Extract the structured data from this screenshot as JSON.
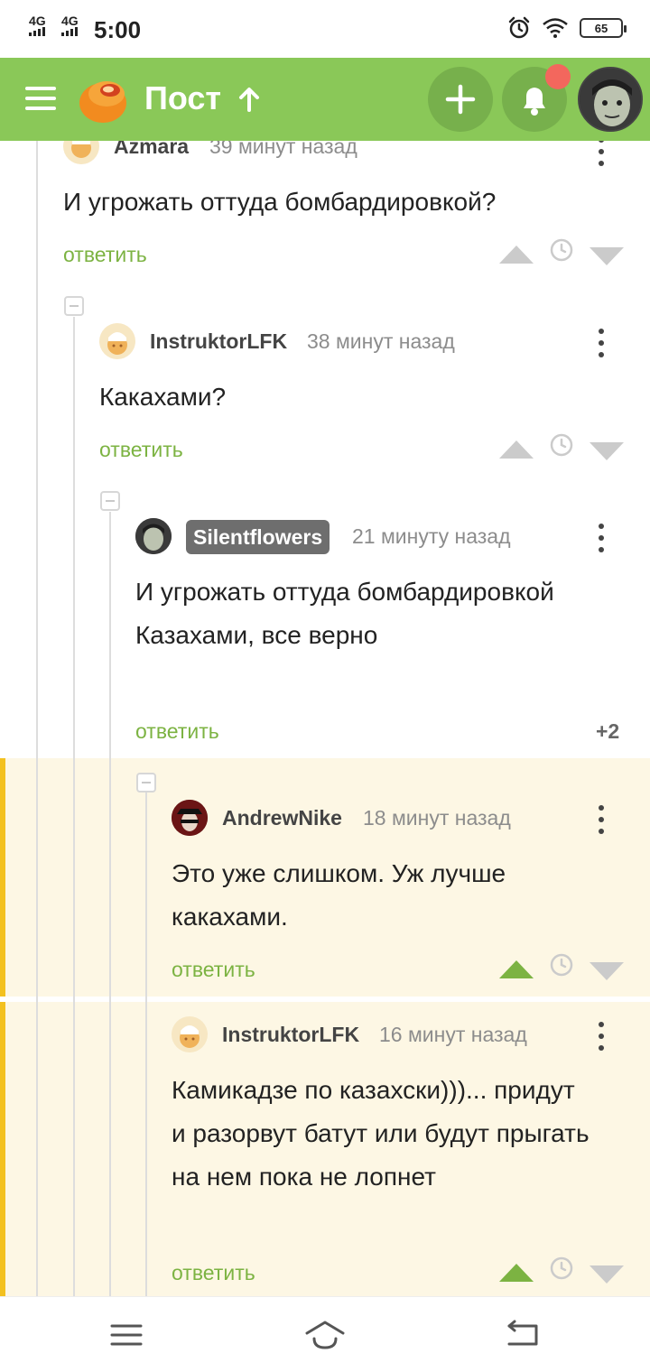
{
  "status_bar": {
    "network1": "4G",
    "network2": "4G",
    "time": "5:00",
    "battery": "65"
  },
  "app_bar": {
    "title": "Пост"
  },
  "comments": [
    {
      "username": "Azmara",
      "time": "39 минут назад",
      "text": "И угрожать оттуда бомбардировкой?",
      "reply": "ответить"
    },
    {
      "username": "InstruktorLFK",
      "time": "38 минут назад",
      "text": "Какахами?",
      "reply": "ответить"
    },
    {
      "username": "Silentflowers",
      "time": "21 минуту назад",
      "text": "И угрожать оттуда бомбардировкой Казахами, все верно",
      "reply": "ответить",
      "rating": "+2"
    },
    {
      "username": "AndrewNike",
      "time": "18 минут назад",
      "text": "Это уже слишком. Уж лучше какахами.",
      "reply": "ответить"
    },
    {
      "username": "InstruktorLFK",
      "time": "16 минут назад",
      "text": "Камикадзе по казахски)))... придут и разорвут батут или будут прыгать на нем пока не лопнет",
      "reply": "ответить"
    }
  ],
  "colors": {
    "app_bar": "#8ac858",
    "accent_green": "#7cb342",
    "highlight_bg": "#fdf7e4",
    "highlight_bar": "#f3c11f",
    "notification": "#f3675d"
  }
}
